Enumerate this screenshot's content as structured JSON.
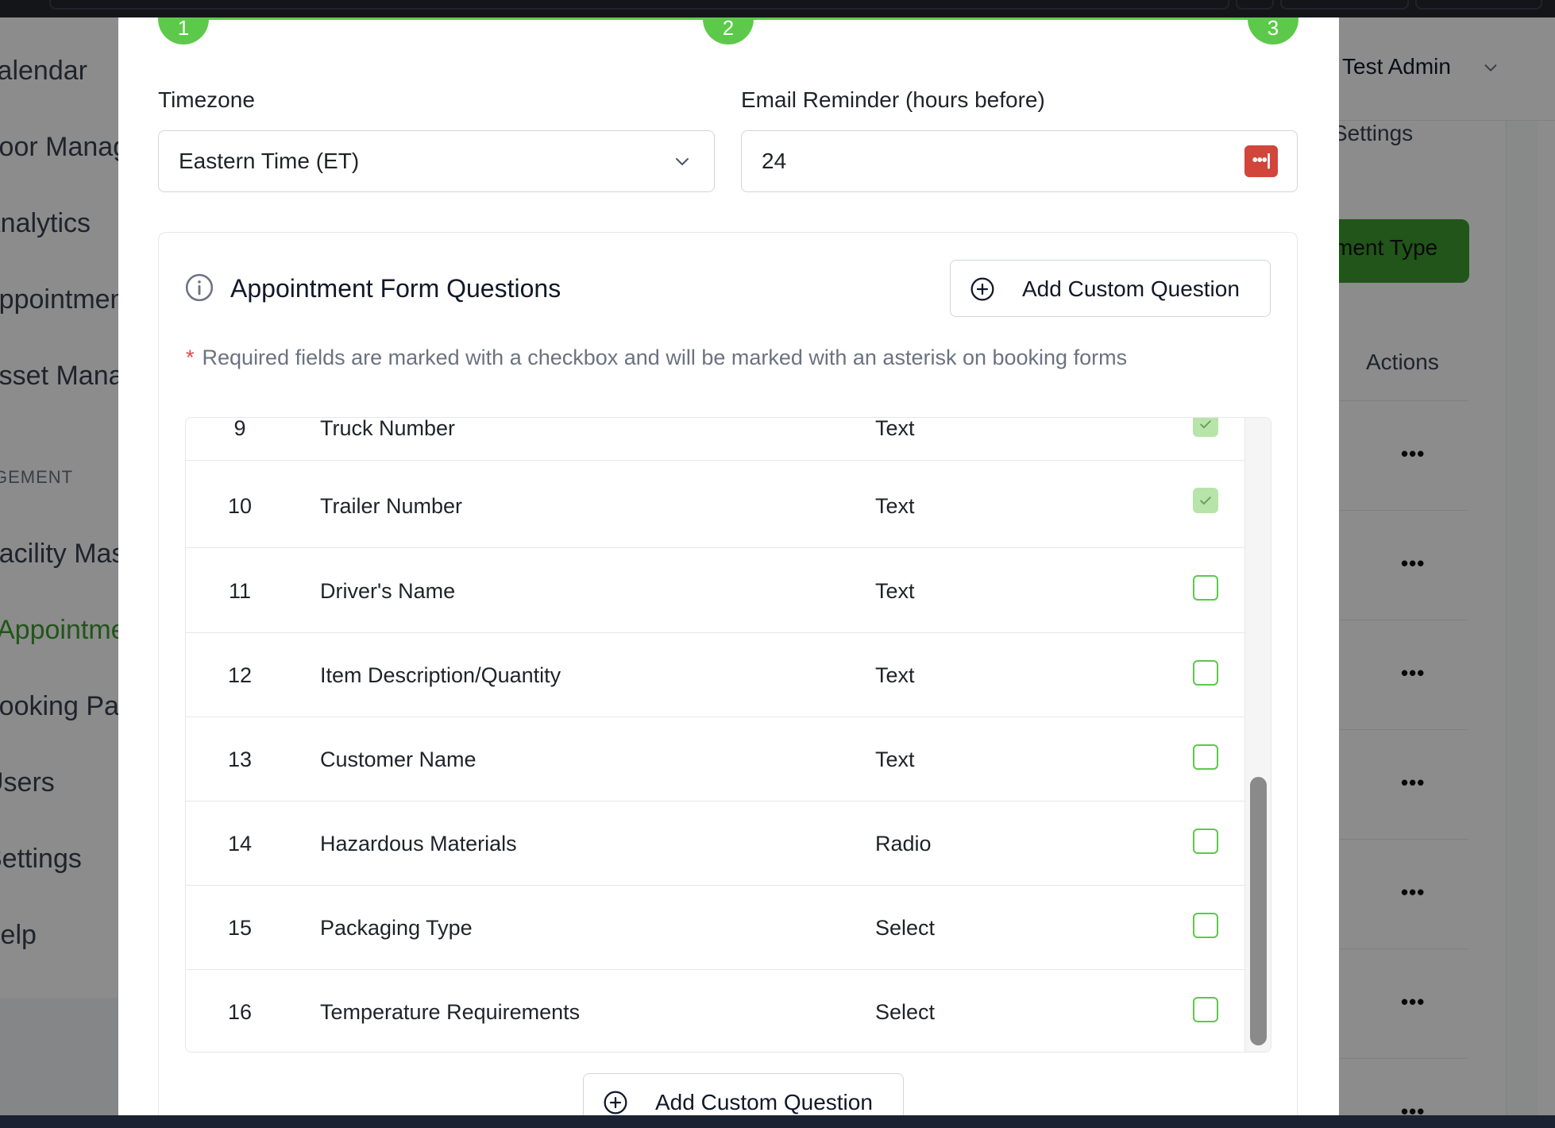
{
  "background": {
    "sidebar_items": [
      {
        "label": "Calendar",
        "active": false
      },
      {
        "label": "Door Manag",
        "active": false
      },
      {
        "label": "Analytics",
        "active": false
      },
      {
        "label": "Appointmen",
        "active": false
      },
      {
        "label": "Asset Mana",
        "active": false
      },
      {
        "label": "Facility Mas",
        "active": false
      },
      {
        "label": "Appointme",
        "active": true
      },
      {
        "label": "Booking Pa",
        "active": false
      },
      {
        "label": "Users",
        "active": false
      },
      {
        "label": "Settings",
        "active": false
      },
      {
        "label": "Help",
        "active": false
      }
    ],
    "sidebar_section": "GEMENT",
    "user_name": "Test Admin",
    "settings_link": "Settings",
    "primary_button": "ment Type",
    "actions_header": "Actions",
    "row_menu": "•••"
  },
  "modal": {
    "steps": [
      "1",
      "2",
      "3"
    ],
    "timezone": {
      "label": "Timezone",
      "value": "Eastern Time (ET)"
    },
    "email_reminder": {
      "label": "Email Reminder (hours before)",
      "value": "24"
    },
    "form_questions": {
      "title": "Appointment Form Questions",
      "add_button": "Add Custom Question",
      "required_note_asterisk": "*",
      "required_note": "Required fields are marked with a checkbox and will be marked with an asterisk on booking forms",
      "questions": [
        {
          "num": "9",
          "name": "Truck Number",
          "type": "Text",
          "required": true
        },
        {
          "num": "10",
          "name": "Trailer Number",
          "type": "Text",
          "required": true
        },
        {
          "num": "11",
          "name": "Driver's Name",
          "type": "Text",
          "required": false
        },
        {
          "num": "12",
          "name": "Item Description/Quantity",
          "type": "Text",
          "required": false
        },
        {
          "num": "13",
          "name": "Customer Name",
          "type": "Text",
          "required": false
        },
        {
          "num": "14",
          "name": "Hazardous Materials",
          "type": "Radio",
          "required": false
        },
        {
          "num": "15",
          "name": "Packaging Type",
          "type": "Select",
          "required": false
        },
        {
          "num": "16",
          "name": "Temperature Requirements",
          "type": "Select",
          "required": false
        }
      ],
      "bottom_add_button": "Add Custom Question"
    }
  },
  "colors": {
    "accent": "#5cc94a",
    "brand_green": "#3c9c2f",
    "password_manager": "#d1453b"
  },
  "icons": [
    "info-icon",
    "plus-circle-icon",
    "chevron-down-icon",
    "check-icon",
    "password-manager-icon"
  ]
}
